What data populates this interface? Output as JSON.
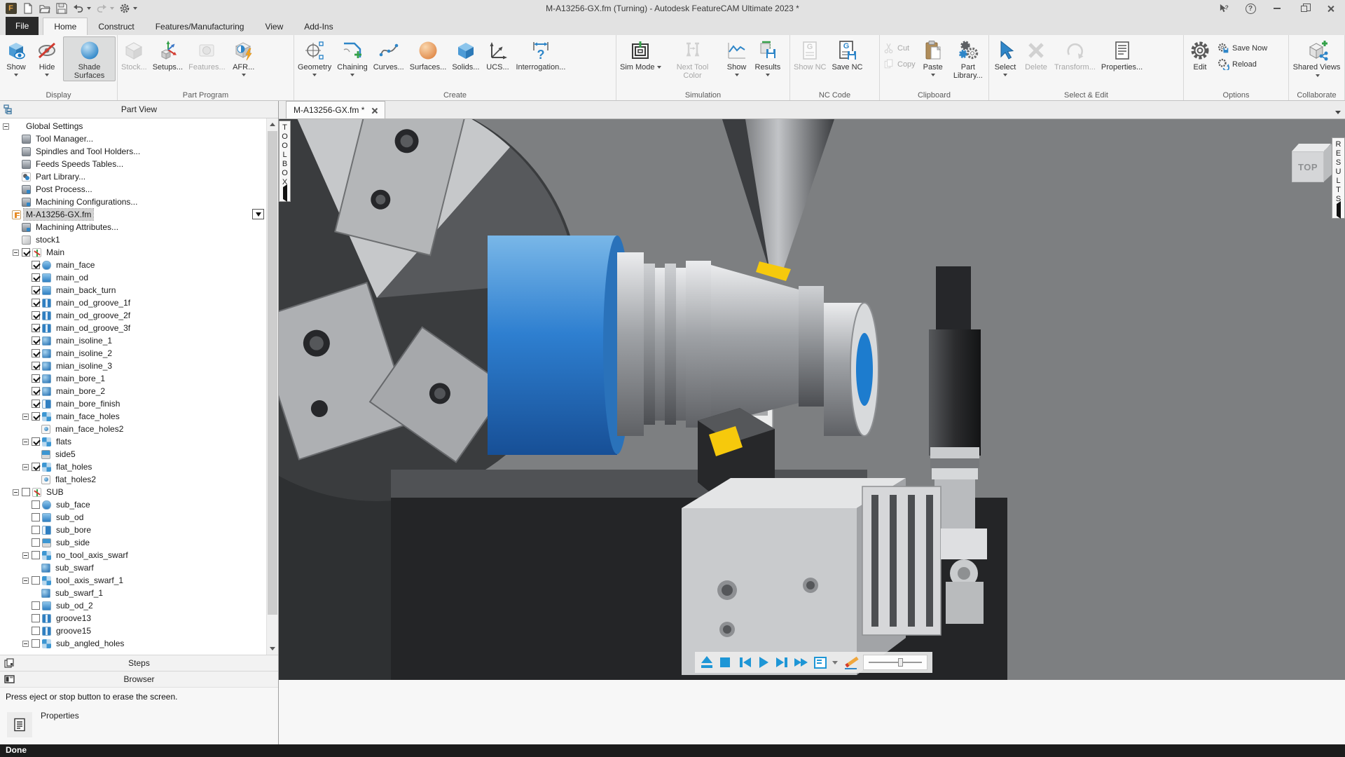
{
  "glyphs": {
    "f": "F",
    "g": "G",
    "q": "?"
  },
  "window": {
    "title": "M-A13256-GX.fm (Turning) - Autodesk FeatureCAM Ultimate 2023 *"
  },
  "tabs": {
    "items": [
      "File",
      "Home",
      "Construct",
      "Features/Manufacturing",
      "View",
      "Add-Ins"
    ],
    "active": "Home"
  },
  "ribbon": {
    "groups": [
      {
        "label": "Display",
        "buttons": [
          {
            "label": "Show",
            "icon": "show",
            "dd": "below"
          },
          {
            "label": "Hide",
            "icon": "hide",
            "dd": "below"
          },
          {
            "label": "Shade Surfaces",
            "icon": "shade",
            "active": true
          }
        ]
      },
      {
        "label": "Part Program",
        "buttons": [
          {
            "label": "Stock...",
            "icon": "stock",
            "disabled": true
          },
          {
            "label": "Setups...",
            "icon": "setups"
          },
          {
            "label": "Features...",
            "icon": "features",
            "disabled": true
          },
          {
            "label": "AFR...",
            "icon": "afr",
            "dd": "below"
          }
        ]
      },
      {
        "label": "Create",
        "buttons": [
          {
            "label": "Geometry",
            "icon": "geometry",
            "dd": "below"
          },
          {
            "label": "Chaining",
            "icon": "chaining",
            "dd": "below"
          },
          {
            "label": "Curves...",
            "icon": "curves"
          },
          {
            "label": "Surfaces...",
            "icon": "surfaces"
          },
          {
            "label": "Solids...",
            "icon": "solids"
          },
          {
            "label": "UCS...",
            "icon": "ucs"
          },
          {
            "label": "Interrogation...",
            "icon": "interrogation"
          }
        ]
      },
      {
        "label": "Simulation",
        "buttons": [
          {
            "label": "Sim Mode",
            "icon": "simmode",
            "dd": "inline"
          },
          {
            "label": "Next Tool Color",
            "icon": "nexttool",
            "disabled": true
          },
          {
            "label": "Show",
            "icon": "simshow",
            "dd": "below"
          },
          {
            "label": "Results",
            "icon": "results",
            "dd": "below"
          }
        ]
      },
      {
        "label": "NC Code",
        "buttons": [
          {
            "label": "Show NC",
            "icon": "shownc",
            "disabled": true
          },
          {
            "label": "Save NC",
            "icon": "savenc"
          }
        ]
      },
      {
        "label": "Clipboard",
        "buttons": [
          {
            "label": "Cut",
            "icon": "cut",
            "disabled": true,
            "small": true
          },
          {
            "label": "Copy",
            "icon": "copy",
            "disabled": true,
            "small": true
          },
          {
            "label": "Paste",
            "icon": "paste",
            "dd": "below"
          },
          {
            "label": "Part Library...",
            "icon": "partlib"
          }
        ]
      },
      {
        "label": "Select & Edit",
        "buttons": [
          {
            "label": "Select",
            "icon": "select",
            "dd": "below"
          },
          {
            "label": "Delete",
            "icon": "delete",
            "disabled": true
          },
          {
            "label": "Transform...",
            "icon": "transform",
            "disabled": true
          },
          {
            "label": "Properties...",
            "icon": "props"
          }
        ]
      },
      {
        "label": "Options",
        "buttons": [
          {
            "label": "Edit",
            "icon": "edit"
          },
          {
            "label": "Save Now",
            "icon": "savenow",
            "small": true
          },
          {
            "label": "Reload",
            "icon": "reload",
            "small": true
          }
        ]
      },
      {
        "label": "Collaborate",
        "buttons": [
          {
            "label": "Shared Views",
            "icon": "shared",
            "dd": "inline"
          }
        ]
      }
    ]
  },
  "document_tab": {
    "label": "M-A13256-GX.fm *"
  },
  "part_view": {
    "title": "Part View",
    "items": [
      {
        "label": "Global Settings",
        "ind": 0,
        "exp": true,
        "icon": "none"
      },
      {
        "label": "Tool Manager...",
        "ind": 1,
        "icon": "tool-manager"
      },
      {
        "label": "Spindles and Tool Holders...",
        "ind": 1,
        "icon": "spindles"
      },
      {
        "label": "Feeds Speeds Tables...",
        "ind": 1,
        "icon": "feeds-speeds"
      },
      {
        "label": "Part Library...",
        "ind": 1,
        "icon": "part-library"
      },
      {
        "label": "Post Process...",
        "ind": 1,
        "icon": "post-process"
      },
      {
        "label": "Machining Configurations...",
        "ind": 1,
        "icon": "machining-config"
      },
      {
        "label": "M-A13256-GX.fm",
        "ind": 0,
        "icon": "featurecam-file",
        "sel": true,
        "dd": true
      },
      {
        "label": "Machining Attributes...",
        "ind": 1,
        "icon": "machining-attributes"
      },
      {
        "label": "stock1",
        "ind": 1,
        "icon": "stock"
      },
      {
        "label": "Main",
        "ind": 1,
        "exp": true,
        "cb": "on",
        "icon": "setup-axis"
      },
      {
        "label": "main_face",
        "ind": 2,
        "cb": "on",
        "icon": "face"
      },
      {
        "label": "main_od",
        "ind": 2,
        "cb": "on",
        "icon": "od"
      },
      {
        "label": "main_back_turn",
        "ind": 2,
        "cb": "on",
        "icon": "od"
      },
      {
        "label": "main_od_groove_1f",
        "ind": 2,
        "cb": "on",
        "icon": "groove"
      },
      {
        "label": "main_od_groove_2f",
        "ind": 2,
        "cb": "on",
        "icon": "groove"
      },
      {
        "label": "main_od_groove_3f",
        "ind": 2,
        "cb": "on",
        "icon": "groove"
      },
      {
        "label": "main_isoline_1",
        "ind": 2,
        "cb": "on",
        "icon": "surface"
      },
      {
        "label": "main_isoline_2",
        "ind": 2,
        "cb": "on",
        "icon": "surface"
      },
      {
        "label": "mian_isoline_3",
        "ind": 2,
        "cb": "on",
        "icon": "surface"
      },
      {
        "label": "main_bore_1",
        "ind": 2,
        "cb": "on",
        "icon": "surface"
      },
      {
        "label": "main_bore_2",
        "ind": 2,
        "cb": "on",
        "icon": "surface"
      },
      {
        "label": "main_bore_finish",
        "ind": 2,
        "cb": "on",
        "icon": "bore"
      },
      {
        "label": "main_face_holes",
        "ind": 2,
        "exp": true,
        "cb": "on",
        "icon": "pattern"
      },
      {
        "label": "main_face_holes2",
        "ind": 3,
        "icon": "hole"
      },
      {
        "label": "flats",
        "ind": 2,
        "exp": true,
        "cb": "on",
        "icon": "pattern"
      },
      {
        "label": "side5",
        "ind": 3,
        "icon": "side"
      },
      {
        "label": "flat_holes",
        "ind": 2,
        "exp": true,
        "cb": "on",
        "icon": "pattern"
      },
      {
        "label": "flat_holes2",
        "ind": 3,
        "icon": "hole"
      },
      {
        "label": "SUB",
        "ind": 1,
        "exp": true,
        "cb": "off",
        "icon": "setup-axis"
      },
      {
        "label": "sub_face",
        "ind": 2,
        "cb": "off",
        "icon": "face"
      },
      {
        "label": "sub_od",
        "ind": 2,
        "cb": "off",
        "icon": "od"
      },
      {
        "label": "sub_bore",
        "ind": 2,
        "cb": "off",
        "icon": "bore"
      },
      {
        "label": "sub_side",
        "ind": 2,
        "cb": "off",
        "icon": "side"
      },
      {
        "label": "no_tool_axis_swarf",
        "ind": 2,
        "exp": true,
        "cb": "off",
        "icon": "pattern"
      },
      {
        "label": "sub_swarf",
        "ind": 3,
        "icon": "surface"
      },
      {
        "label": "tool_axis_swarf_1",
        "ind": 2,
        "exp": true,
        "cb": "off",
        "icon": "pattern"
      },
      {
        "label": "sub_swarf_1",
        "ind": 3,
        "icon": "surface"
      },
      {
        "label": "sub_od_2",
        "ind": 2,
        "cb": "off",
        "icon": "od"
      },
      {
        "label": "groove13",
        "ind": 2,
        "cb": "off",
        "icon": "groove"
      },
      {
        "label": "groove15",
        "ind": 2,
        "cb": "off",
        "icon": "groove"
      },
      {
        "label": "sub_angled_holes",
        "ind": 2,
        "exp": true,
        "cb": "off",
        "icon": "pattern"
      }
    ]
  },
  "panels": {
    "steps": "Steps",
    "browser": "Browser"
  },
  "status": {
    "message": "Press eject or stop button to erase the screen.",
    "properties": "Properties",
    "done": "Done"
  },
  "viewport": {
    "toolbox_tab": "TOOLBOX",
    "results_tab": "RESULTS",
    "view_cube_top": "TOP"
  }
}
